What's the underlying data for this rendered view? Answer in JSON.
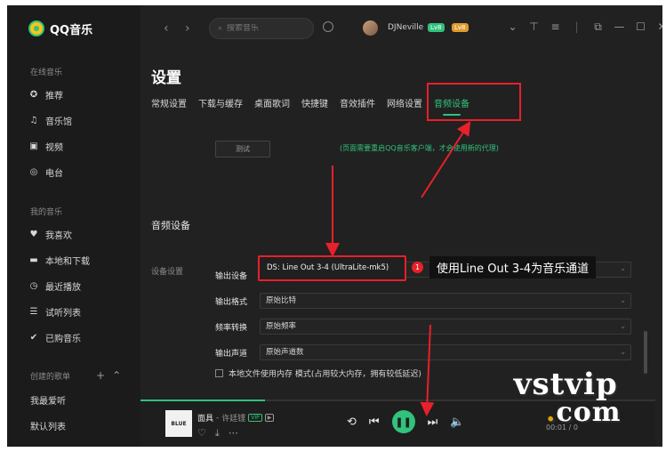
{
  "app": {
    "logo_text": "QQ音乐"
  },
  "sidebar": {
    "online_title": "在线音乐",
    "online_items": [
      {
        "label": "推荐",
        "icon": "star-icon"
      },
      {
        "label": "音乐馆",
        "icon": "music-note-icon"
      },
      {
        "label": "视频",
        "icon": "video-icon"
      },
      {
        "label": "电台",
        "icon": "radio-icon"
      }
    ],
    "my_title": "我的音乐",
    "my_items": [
      {
        "label": "我喜欢",
        "icon": "heart-icon"
      },
      {
        "label": "本地和下载",
        "icon": "computer-icon"
      },
      {
        "label": "最近播放",
        "icon": "clock-icon"
      },
      {
        "label": "试听列表",
        "icon": "list-icon"
      },
      {
        "label": "已购音乐",
        "icon": "check-circle-icon"
      }
    ],
    "created_title": "创建的歌单",
    "playlists": [
      "我最爱听",
      "默认列表"
    ]
  },
  "titlebar": {
    "search_placeholder": "搜索音乐",
    "username": "DJNeville",
    "badge1": "Lv8",
    "badge2": "Lv8"
  },
  "settings": {
    "title": "设置",
    "tabs": [
      "常规设置",
      "下载与缓存",
      "桌面歌词",
      "快捷键",
      "音效插件",
      "网络设置",
      "音频设备"
    ],
    "active_tab": "音频设备",
    "test_button": "测试",
    "proxy_note": "(页面需要重启QQ音乐客户端，才会使用新的代理)",
    "section_heading": "音频设备",
    "device_settings_label": "设备设置",
    "fields": [
      {
        "label": "输出设备",
        "value": "DS: Line Out 3-4 (UltraLite-mk5)"
      },
      {
        "label": "输出格式",
        "value": "原始比特"
      },
      {
        "label": "频率转换",
        "value": "原始频率"
      },
      {
        "label": "输出声道",
        "value": "原始声道数"
      }
    ],
    "checkbox_label": "本地文件使用内存 模式(占用较大内存，拥有较低延迟)"
  },
  "annotation": {
    "number": "1",
    "text": "使用Line Out 3-4为音乐通道"
  },
  "player": {
    "song_title": "面具",
    "artist": "许廷铿",
    "vip": "VIP",
    "cover_text": "BLUE",
    "time": "00:01 / 0"
  },
  "watermark": {
    "line1": "vstvip",
    "dot": ".",
    "line2": "com"
  },
  "colors": {
    "accent": "#31c27c",
    "annotation": "#e8202a",
    "background": "#212121"
  }
}
